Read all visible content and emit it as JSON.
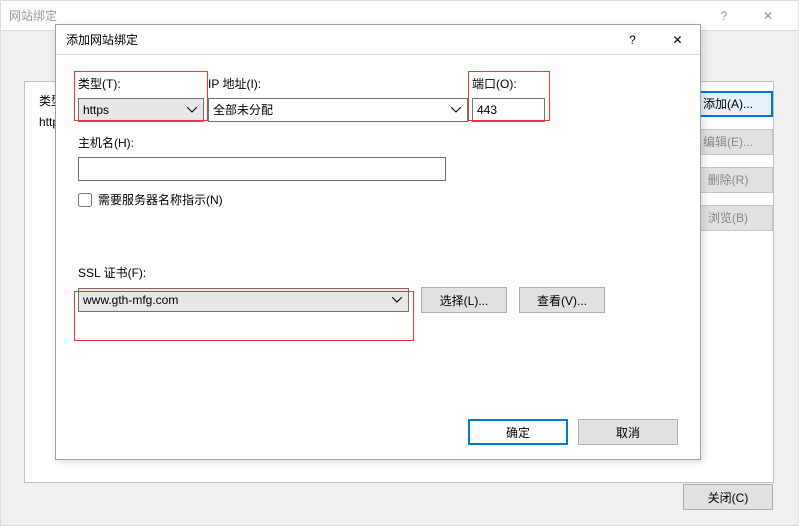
{
  "parent": {
    "title": "网站绑定",
    "help": "?",
    "close": "✕",
    "col_type": "类型",
    "row_https": "https",
    "buttons": {
      "add": "添加(A)...",
      "edit": "编辑(E)...",
      "remove": "删除(R)",
      "browse": "浏览(B)",
      "close": "关闭(C)"
    }
  },
  "child": {
    "title": "添加网站绑定",
    "help": "?",
    "close": "✕",
    "fields": {
      "type_label": "类型(T):",
      "type_value": "https",
      "ip_label": "IP 地址(I):",
      "ip_value": "全部未分配",
      "port_label": "端口(O):",
      "port_value": "443",
      "hostname_label": "主机名(H):",
      "hostname_value": "",
      "sni_label": "需要服务器名称指示(N)",
      "ssl_label": "SSL 证书(F):",
      "ssl_value": "www.gth-mfg.com"
    },
    "buttons": {
      "select": "选择(L)...",
      "view": "查看(V)...",
      "ok": "确定",
      "cancel": "取消"
    }
  }
}
